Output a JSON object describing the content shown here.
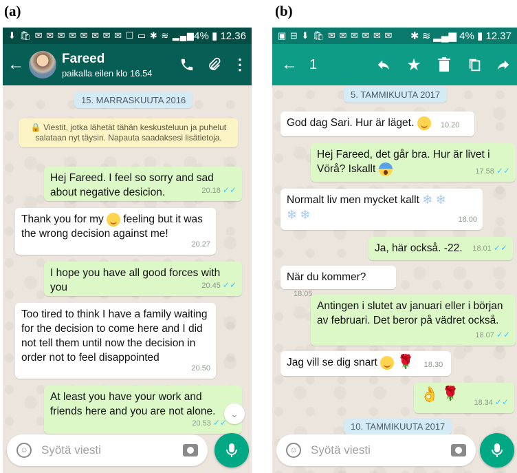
{
  "labels": {
    "a": "(a)",
    "b": "(b)"
  },
  "phoneA": {
    "status_icons": "⬇ 🛍 ✉ ✉ ✉ ✉ ✉ ✉ ✉ ✉ ☐ ▭ ✱ ≋ ▂▄▆",
    "battery": "4%",
    "clock": "12.36",
    "contact_name": "Fareed",
    "contact_status": "paikalla eilen klo 16.54",
    "date_chip": "15. MARRASKUUTA 2016",
    "encryption_notice": "🔒 Viestit, jotka lähetät tähän keskusteluun ja puhelut salataan nyt täysin. Napauta saadaksesi lisätietoja.",
    "messages": [
      {
        "dir": "out",
        "text": "Hej Fareed. I feel so sorry and sad about negative desicion.",
        "time": "20.18",
        "tick": "✓✓"
      },
      {
        "dir": "in",
        "text_before": "Thank you for my",
        "text_after": "feeling but it was the wrong decision against me!",
        "emoji": "smile",
        "time": "20.27"
      },
      {
        "dir": "out",
        "text": "I hope you have all good forces with you",
        "time": "20.45",
        "tick": "✓✓"
      },
      {
        "dir": "in",
        "text": "Too tired to think I have a family waiting for the decision to come here and I did not tell them until now the decision in order not to feel disappointed",
        "time": "20.50"
      },
      {
        "dir": "out",
        "text": "At least you have your work and friends here and you are not alone.",
        "time": "20.53",
        "tick": "✓✓"
      }
    ],
    "input_placeholder": "Syötä viesti"
  },
  "phoneB": {
    "status_icons": "▣ ⊟ ⬇ 🛍 ✉ ✉ ✉ ✉ ✉ ✉",
    "battery": "4%",
    "clock": "12.37",
    "selected_count": "1",
    "date_chip_top": "5. TAMMIKUUTA 2017",
    "date_chip_bottom": "10. TAMMIKUUTA 2017",
    "messages": [
      {
        "dir": "in",
        "text": "God dag Sari. Hur är läget.",
        "emoji": "smile",
        "time": "10.20"
      },
      {
        "dir": "out",
        "text_line1": "Hej Fareed, det går bra. Hur är livet i",
        "text_line2": "Vörå? Iskallt",
        "emoji": "scream",
        "time": "17.58",
        "tick": "✓✓"
      },
      {
        "dir": "in",
        "text": "Normalt liv men mycket kallt",
        "emoji": "snowflakes",
        "time": "18.00"
      },
      {
        "dir": "out",
        "text": "Ja, här också. -22.",
        "time": "18.01",
        "tick": "✓✓"
      },
      {
        "dir": "in",
        "text": "När du kommer?",
        "time": "18.05"
      },
      {
        "dir": "out",
        "text": "Antingen i slutet av januari eller i början av februari. Det beror på vädret också.",
        "time": "18.07",
        "tick": "✓✓"
      },
      {
        "dir": "in",
        "text": "Jag vill se dig snart",
        "emoji": "smile-rose",
        "time": "18.30"
      },
      {
        "dir": "out",
        "text": "",
        "emoji": "ok-rose",
        "time": "18.34",
        "tick": "✓✓"
      }
    ],
    "input_placeholder": "Syötä viesti"
  },
  "glyphs": {
    "flake": "❄",
    "rose": "🌹",
    "ok": "👌",
    "lock": "🔒",
    "chevron": "⌄"
  }
}
